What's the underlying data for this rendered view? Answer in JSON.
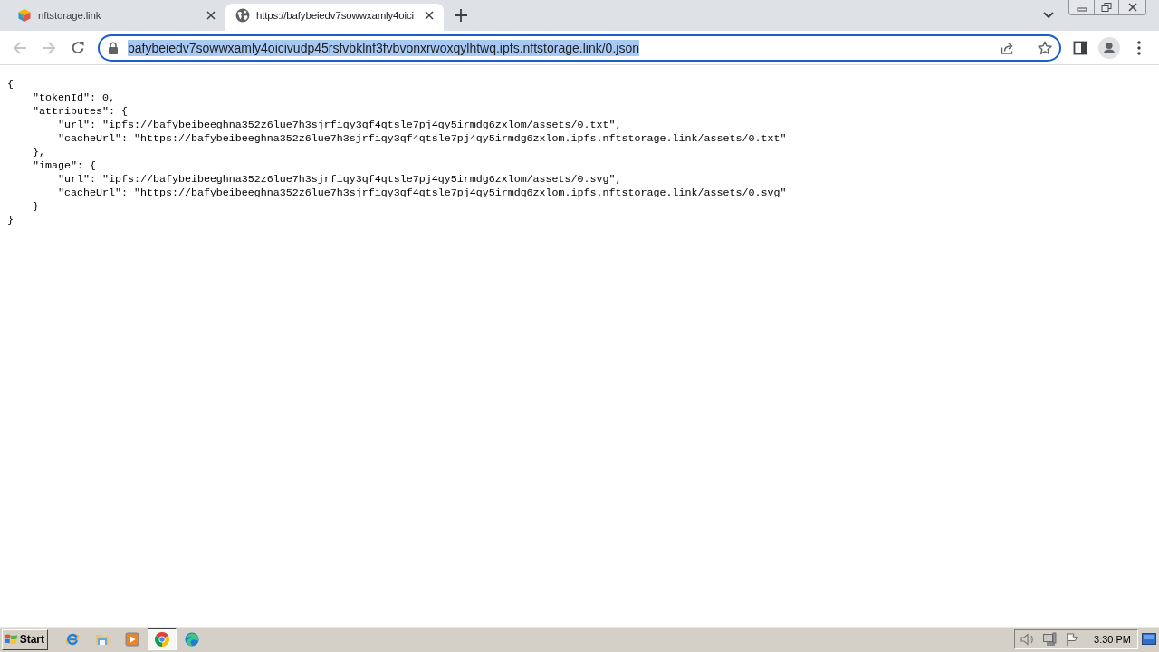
{
  "browser": {
    "tabs": [
      {
        "title": "nftstorage.link",
        "selected": false
      },
      {
        "title": "https://bafybeiedv7sowwxamly4oici",
        "selected": true
      }
    ],
    "back_button": {
      "disabled": true
    },
    "forward_button": {
      "disabled": true
    },
    "address_bar": {
      "value": "bafybeiedv7sowwxamly4oicivudp45rsfvbklnf3fvbvonxrwoxqylhtwq.ipfs.nftstorage.link/0.json",
      "focused": true,
      "text_selected": true
    }
  },
  "document": {
    "lines": [
      {
        "text": "{",
        "children": [
          {
            "text": "\"tokenId\": 0,"
          },
          {
            "text": "\"attributes\": {",
            "children": [
              {
                "text": "\"url\": \"ipfs://bafybeibeeghna352z6lue7h3sjrfiqy3qf4qtsle7pj4qy5irmdg6zxlom/assets/0.txt\","
              },
              {
                "text": "\"cacheUrl\": \"https://bafybeibeeghna352z6lue7h3sjrfiqy3qf4qtsle7pj4qy5irmdg6zxlom.ipfs.nftstorage.link/assets/0.txt\""
              }
            ]
          },
          {
            "text": "},"
          },
          {
            "text": "\"image\": {",
            "children": [
              {
                "text": "\"url\": \"ipfs://bafybeibeeghna352z6lue7h3sjrfiqy3qf4qtsle7pj4qy5irmdg6zxlom/assets/0.svg\","
              },
              {
                "text": "\"cacheUrl\": \"https://bafybeibeeghna352z6lue7h3sjrfiqy3qf4qtsle7pj4qy5irmdg6zxlom.ipfs.nftstorage.link/assets/0.svg\""
              }
            ]
          },
          {
            "text": "}"
          }
        ]
      },
      {
        "text": "}"
      }
    ]
  },
  "taskbar": {
    "start_label": "Start",
    "quick_launch": [
      {
        "active": false
      },
      {
        "active": false
      },
      {
        "active": false
      },
      {
        "active": true
      },
      {
        "active": false
      }
    ],
    "clock": "3:30 PM"
  }
}
